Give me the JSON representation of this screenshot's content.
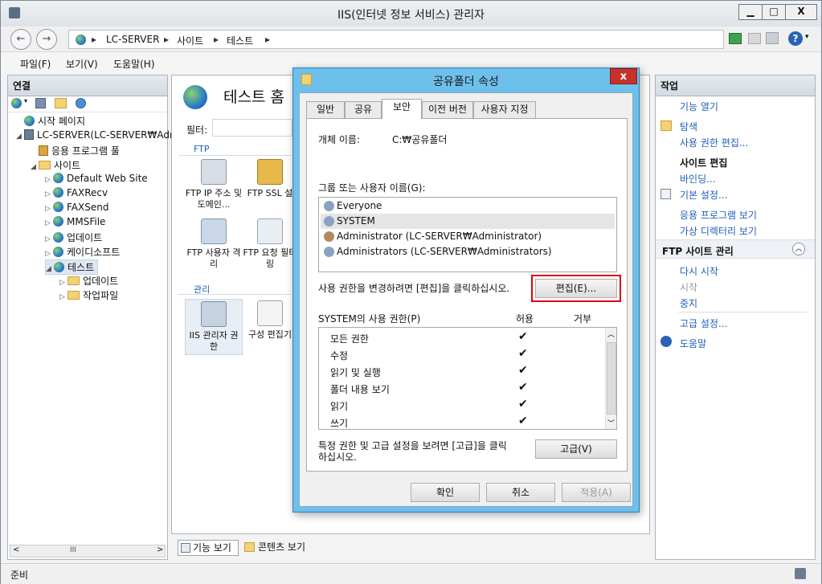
{
  "window": {
    "title": "IIS(인터넷 정보 서비스) 관리자",
    "controls": {
      "minimize": "▁",
      "maximize": "□",
      "close": "X"
    }
  },
  "address": {
    "crumbs": [
      "LC-SERVER",
      "사이트",
      "테스트"
    ],
    "separator": "▸",
    "help_label": "?"
  },
  "menu": [
    "파일(F)",
    "보기(V)",
    "도움말(H)"
  ],
  "connections": {
    "header": "연결",
    "tree": [
      {
        "label": "시작 페이지",
        "icon": "start-page-icon"
      },
      {
        "label": "LC-SERVER(LC-SERVER₩Adr",
        "icon": "server-icon"
      },
      {
        "label": "응용 프로그램 풀",
        "icon": "app-pool-icon"
      },
      {
        "label": "사이트",
        "icon": "sites-folder-icon"
      },
      {
        "label": "Default Web Site",
        "icon": "globe-icon"
      },
      {
        "label": "FAXRecv",
        "icon": "globe-icon"
      },
      {
        "label": "FAXSend",
        "icon": "globe-icon"
      },
      {
        "label": "MMSFile",
        "icon": "globe-icon"
      },
      {
        "label": "업데이트",
        "icon": "globe-icon"
      },
      {
        "label": "케이디소프트",
        "icon": "globe-icon"
      },
      {
        "label": "테스트",
        "icon": "globe-icon"
      },
      {
        "label": "업데이트",
        "icon": "folder-icon"
      },
      {
        "label": "작업파일",
        "icon": "folder-icon"
      }
    ],
    "hscroll_thumb": "III"
  },
  "center": {
    "title": "테스트 홈",
    "filter_label": "필터:",
    "group_ftp": "FTP",
    "group_manage": "관리",
    "features": [
      "FTP IP 주소 및 도메인...",
      "FTP SSL 설",
      "FTP 사용자 격리",
      "FTP 요청 필터링",
      "IIS 관리자 권한",
      "구성 편집기"
    ],
    "view_tabs": [
      "기능 보기",
      "콘텐츠 보기"
    ]
  },
  "actions": {
    "header": "작업",
    "items": {
      "open_feature": "기능 열기",
      "explore": "탐색",
      "edit_perms": "사용 권한 편집...",
      "edit_site": "사이트 편집",
      "bindings": "바인딩...",
      "basic_settings": "기본 설정...",
      "view_apps": "응용 프로그램 보기",
      "view_vdirs": "가상 디렉터리 보기",
      "ftp_manage": "FTP 사이트 관리",
      "restart": "다시 시작",
      "start": "시작",
      "stop": "중지",
      "advanced": "고급 설정...",
      "help": "도움말"
    }
  },
  "dialog": {
    "title": "공유폴더 속성",
    "close": "x",
    "tabs": [
      "일반",
      "공유",
      "보안",
      "이전 버전",
      "사용자 지정"
    ],
    "active_tab": "보안",
    "object_label": "개체 이름:",
    "object_value": "C:₩공유폴더",
    "group_label": "그룹 또는 사용자 이름(G):",
    "users": [
      "Everyone",
      "SYSTEM",
      "Administrator (LC-SERVER₩Administrator)",
      "Administrators (LC-SERVER₩Administrators)"
    ],
    "selected_user": "SYSTEM",
    "edit_hint": "사용 권한을 변경하려면 [편집]을 클릭하십시오.",
    "edit_button": "편집(E)...",
    "perm_label": "SYSTEM의 사용 권한(P)",
    "allow_label": "허용",
    "deny_label": "거부",
    "permissions": [
      {
        "name": "모든 권한",
        "allow": "✔"
      },
      {
        "name": "수정",
        "allow": "✔"
      },
      {
        "name": "읽기 및 실행",
        "allow": "✔"
      },
      {
        "name": "폴더 내용 보기",
        "allow": "✔"
      },
      {
        "name": "읽기",
        "allow": "✔"
      },
      {
        "name": "쓰기",
        "allow": "✔"
      }
    ],
    "advanced_hint_1": "특정 권한 및 고급 설정을 보려면 [고급]을 클릭",
    "advanced_hint_2": "하십시오.",
    "advanced_button": "고급(V)",
    "ok": "확인",
    "cancel": "취소",
    "apply": "적용(A)"
  },
  "status": {
    "text": "준비"
  },
  "colors": {
    "accent": "#1f5fb8",
    "dialog_frame": "#6ec0ec",
    "highlight": "#e00000"
  }
}
